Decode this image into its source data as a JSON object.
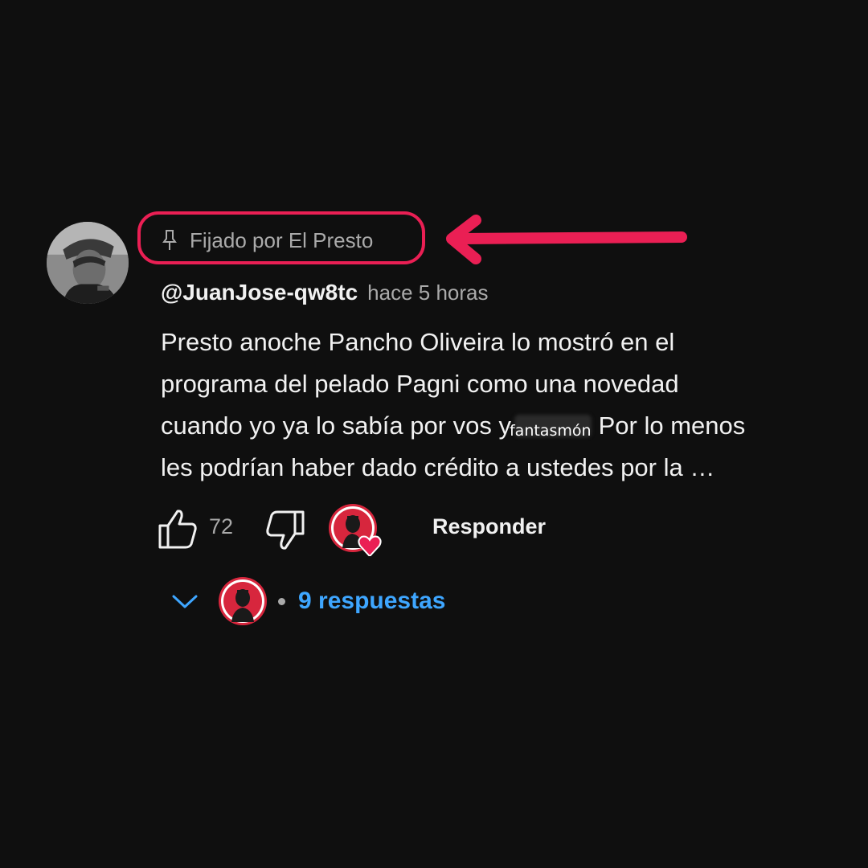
{
  "comment": {
    "pinned_label": "Fijado por El Presto",
    "author": "@JuanJose-qw8tc",
    "time": "hace 5 horas",
    "body_lines": [
      "Presto anoche Pancho Oliveira lo mostró en el",
      "programa del pelado Pagni como una novedad",
      "cuando yo ya lo sabía por vos y",
      "les podrían haber dado crédito a ustedes por la …"
    ],
    "body_line3_after": "Por lo menos",
    "redaction_overlay": "fantasmón",
    "like_count": "72",
    "reply_label": "Responder",
    "replies_label": "9 respuestas"
  },
  "colors": {
    "background": "#0f0f0f",
    "text_primary": "#f1f1f1",
    "text_secondary": "#aaaaaa",
    "highlight": "#ea1f54",
    "link_blue": "#3ea6ff"
  },
  "icons": {
    "pin": "pin-icon",
    "like": "thumbs-up-icon",
    "dislike": "thumbs-down-icon",
    "creator_heart": "creator-heart-icon",
    "expand": "chevron-down-icon"
  }
}
